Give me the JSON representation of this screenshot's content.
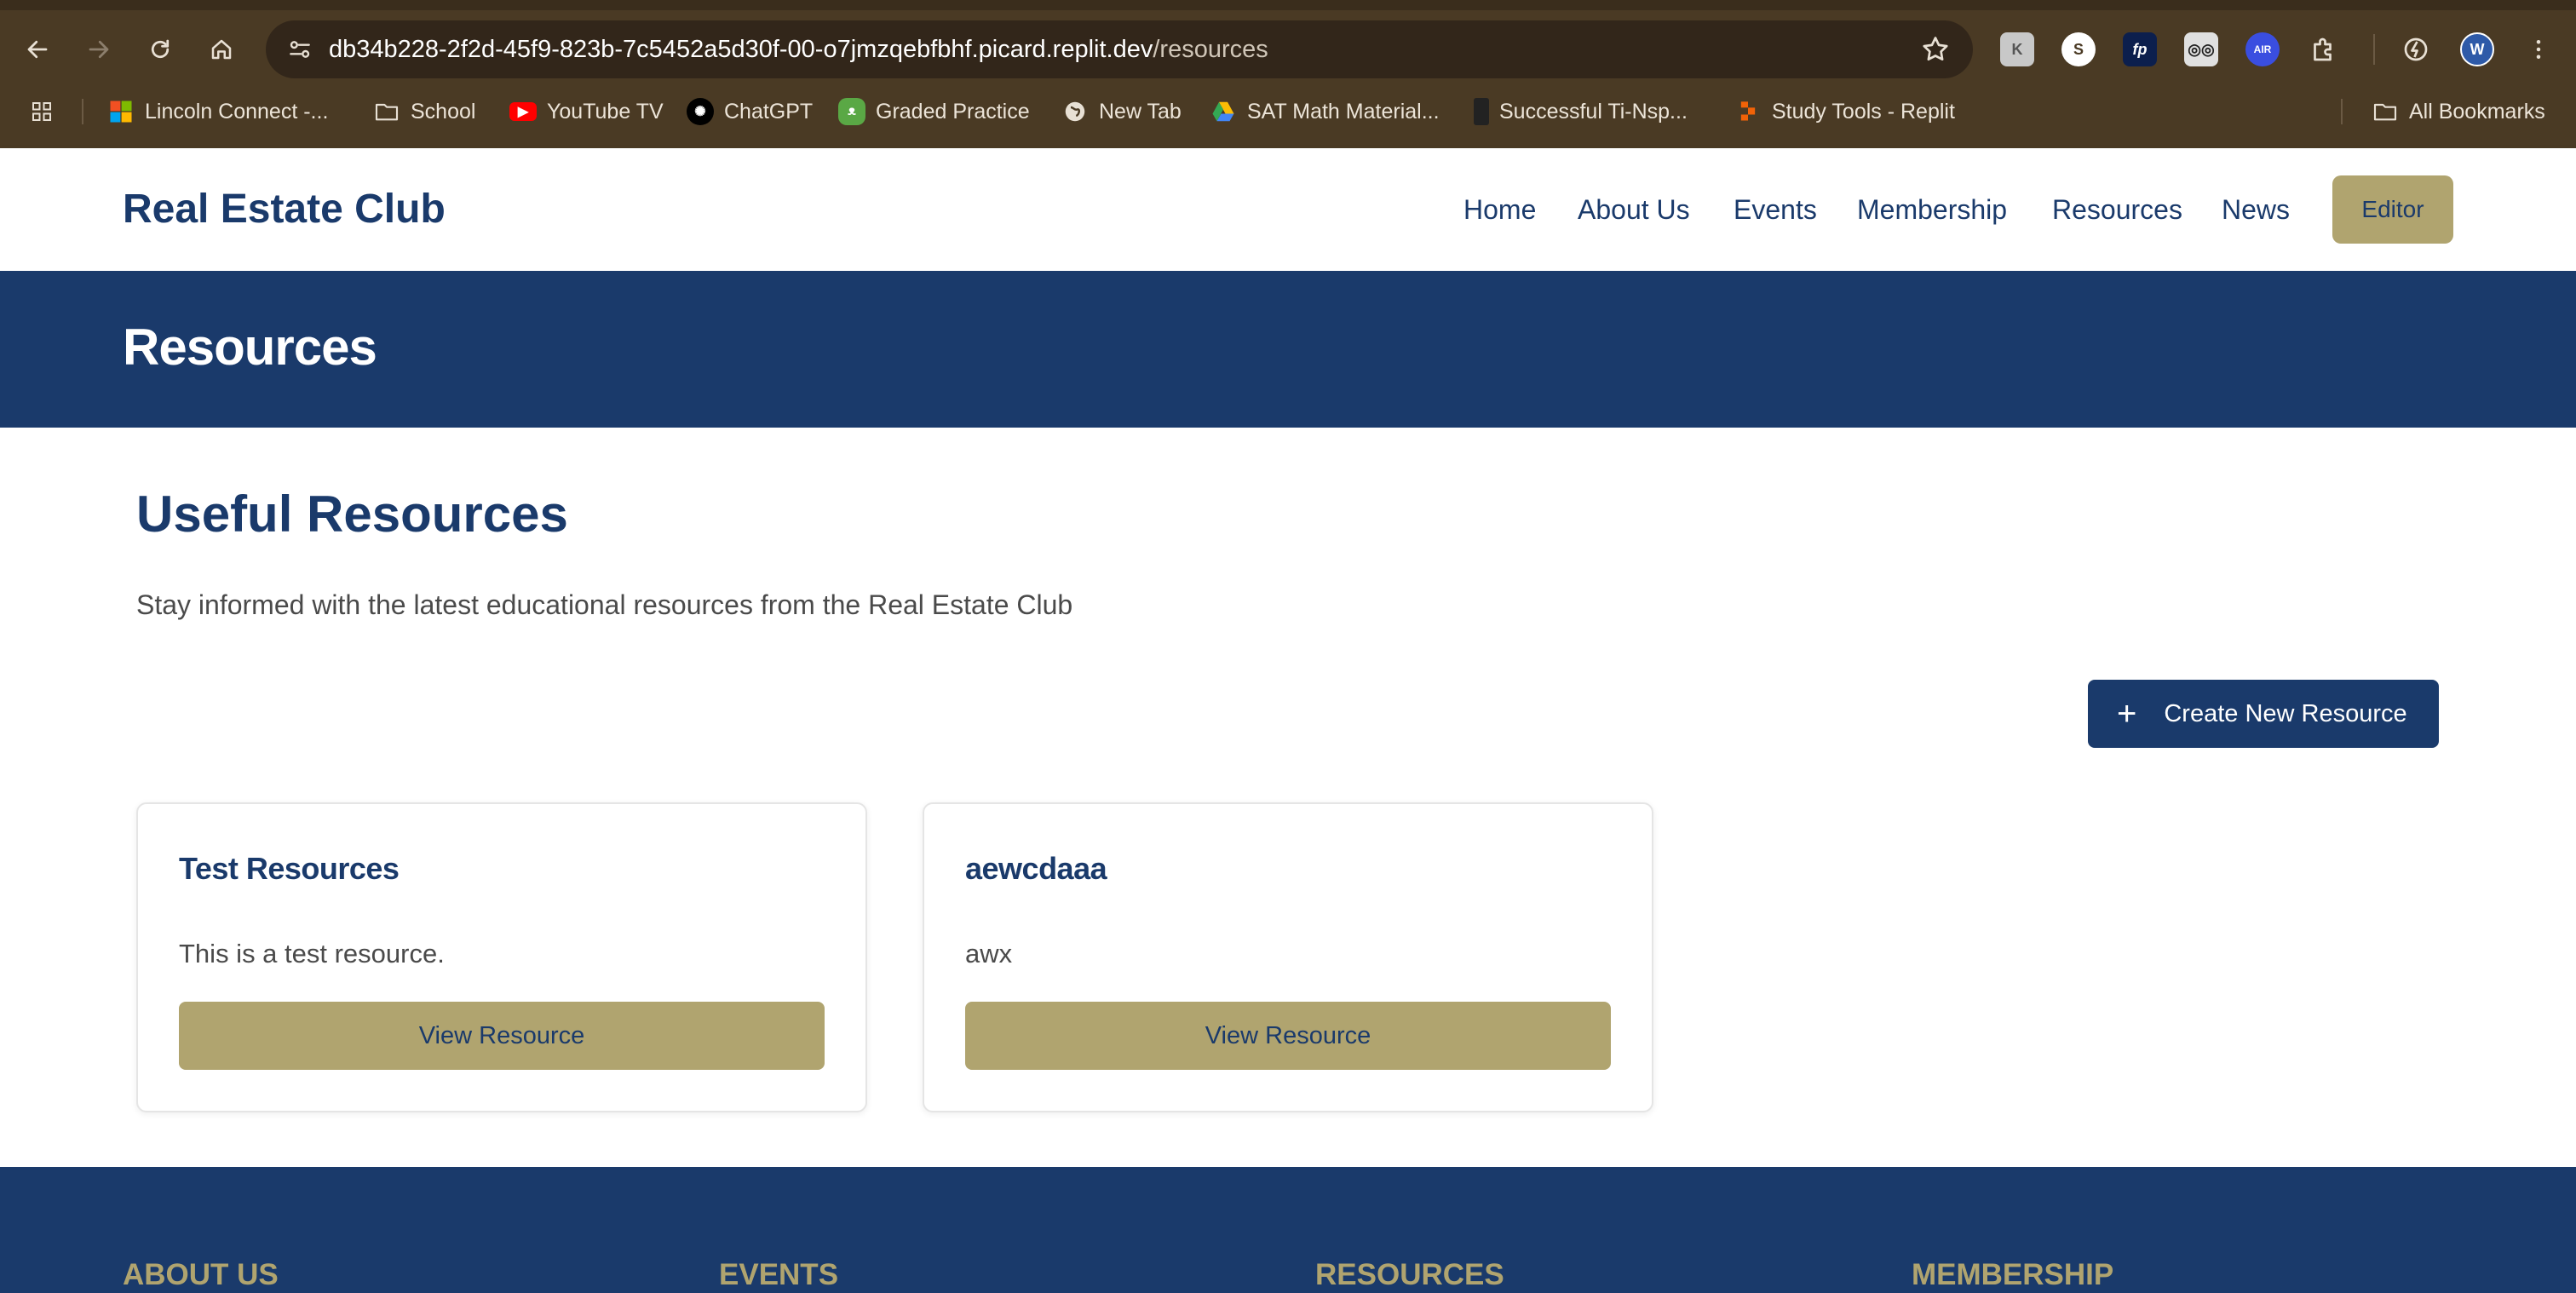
{
  "browser": {
    "url_host": "db34b228-2f2d-45f9-823b-7c5452a5d30f-00-o7jmzqebfbhf.picard.replit.dev",
    "url_path": "/resources",
    "extensions": [
      "extension-icon",
      "s-icon",
      "fp-icon",
      "glasses-icon",
      "air-icon",
      "puzzle-icon",
      "replit-icon"
    ],
    "profile_initial": "W",
    "bookmarks": [
      {
        "label": "Lincoln Connect -...",
        "icon": "microsoft-icon"
      },
      {
        "label": "School",
        "icon": "folder-icon"
      },
      {
        "label": "YouTube TV",
        "icon": "youtube-icon"
      },
      {
        "label": "ChatGPT",
        "icon": "chatgpt-icon"
      },
      {
        "label": "Graded Practice",
        "icon": "frog-icon"
      },
      {
        "label": "New Tab",
        "icon": "globe-icon"
      },
      {
        "label": "SAT Math Material...",
        "icon": "drive-icon"
      },
      {
        "label": "Successful Ti-Nsp...",
        "icon": "calculator-icon"
      },
      {
        "label": "Study Tools - Replit",
        "icon": "replit-icon"
      }
    ],
    "all_bookmarks": "All Bookmarks"
  },
  "header": {
    "brand": "Real Estate Club",
    "nav": [
      "Home",
      "About Us",
      "Events",
      "Membership",
      "Resources",
      "News"
    ],
    "editor": "Editor"
  },
  "banner": {
    "title": "Resources"
  },
  "main": {
    "title": "Useful Resources",
    "description": "Stay informed with the latest educational resources from the Real Estate Club",
    "create_button": "Create New Resource",
    "cards": [
      {
        "title": "Test Resources",
        "description": "This is a test resource.",
        "button": "View Resource"
      },
      {
        "title": "aewcdaaa",
        "description": "awx",
        "button": "View Resource"
      }
    ]
  },
  "footer": {
    "headings": [
      "ABOUT US",
      "EVENTS",
      "RESOURCES",
      "MEMBERSHIP"
    ]
  },
  "colors": {
    "primary": "#1a3a6b",
    "accent": "#b0a46f",
    "chrome": "#4a3a24"
  }
}
